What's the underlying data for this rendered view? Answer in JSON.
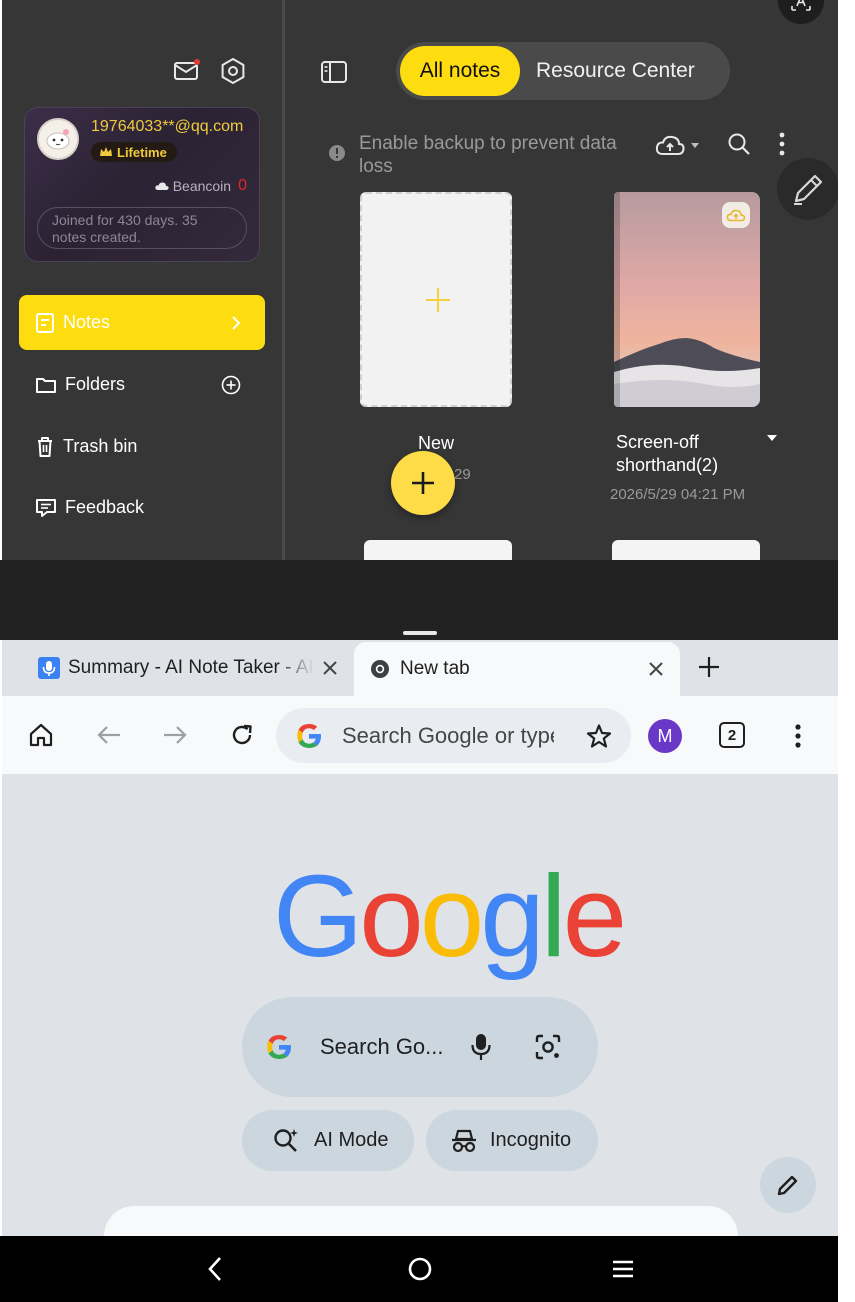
{
  "notes_app": {
    "profile": {
      "email": "19764033**@qq.com",
      "badge": "Lifetime",
      "beancoin_label": "Beancoin",
      "beancoin_value": "0",
      "joined_text": "Joined for 430 days. 35 notes created."
    },
    "nav": [
      {
        "label": "Notes"
      },
      {
        "label": "Folders"
      },
      {
        "label": "Trash bin"
      },
      {
        "label": "Feedback"
      }
    ],
    "tabs": {
      "all": "All notes",
      "resource": "Resource Center"
    },
    "backup_warning": "Enable backup to prevent data loss",
    "notes": [
      {
        "title": "New",
        "date": "29"
      },
      {
        "title": "Screen-off shorthand(2)",
        "date": "2026/5/29 04:21 PM"
      }
    ],
    "colors": {
      "accent": "#fddc10",
      "background": "#363636",
      "beancoin": "#e32626"
    }
  },
  "browser": {
    "tabs": [
      {
        "title": "Summary - AI Note Taker - AI Transcribe"
      },
      {
        "title": "New tab"
      }
    ],
    "omnibox_placeholder": "Search Google or type URL",
    "profile_initial": "M",
    "tab_count": "2",
    "logo": [
      "G",
      "o",
      "o",
      "g",
      "l",
      "e"
    ],
    "ntp_search_text": "Search Go...",
    "chips": {
      "ai_mode": "AI Mode",
      "incognito": "Incognito"
    },
    "colors": {
      "blue": "#4285f4",
      "red": "#ea4335",
      "yellow": "#fbbc05",
      "green": "#34a853",
      "profile": "#6a38c7"
    }
  }
}
